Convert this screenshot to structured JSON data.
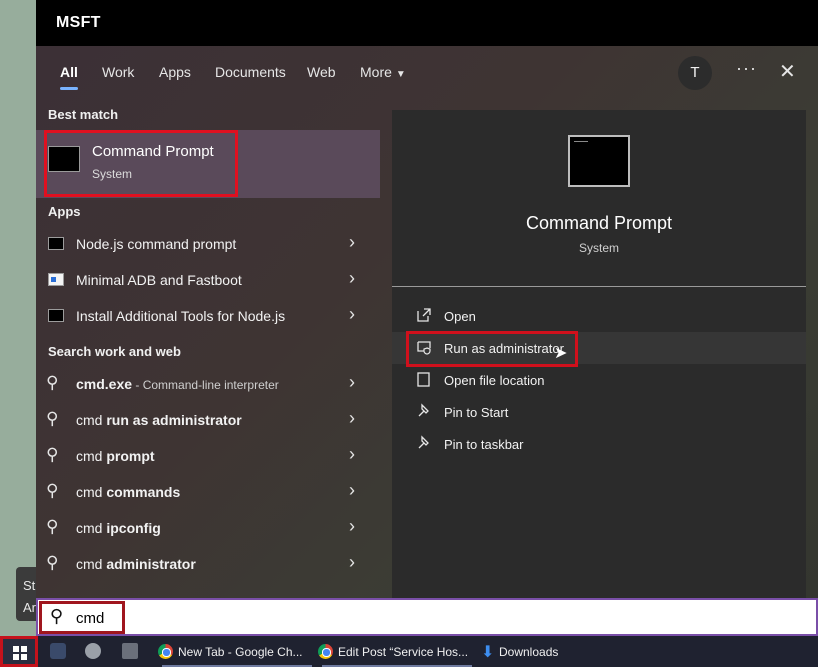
{
  "desktop": {
    "tooltip_line1": "St",
    "tooltip_line2": "Ar"
  },
  "window": {
    "title": "MSFT"
  },
  "tabs": [
    {
      "label": "All",
      "active": true
    },
    {
      "label": "Work"
    },
    {
      "label": "Apps"
    },
    {
      "label": "Documents"
    },
    {
      "label": "Web"
    },
    {
      "label": "More"
    }
  ],
  "account": {
    "avatar_initial": "T"
  },
  "header_actions": {
    "more_glyph": "···",
    "close_glyph": "✕"
  },
  "best_match": {
    "heading": "Best match",
    "name": "Command Prompt",
    "subtitle": "System"
  },
  "apps": {
    "heading": "Apps",
    "items": [
      {
        "label": "Node.js command prompt",
        "icon": "terminal-icon"
      },
      {
        "label": "Minimal ADB and Fastboot",
        "icon": "adb-icon"
      },
      {
        "label": "Install Additional Tools for Node.js",
        "icon": "terminal-icon"
      }
    ]
  },
  "web": {
    "heading": "Search work and web",
    "items": [
      {
        "prefix": "cmd.exe",
        "bold": "",
        "desc": " - Command-line interpreter"
      },
      {
        "prefix": "cmd ",
        "bold": "run as administrator",
        "desc": ""
      },
      {
        "prefix": "cmd ",
        "bold": "prompt",
        "desc": ""
      },
      {
        "prefix": "cmd ",
        "bold": "commands",
        "desc": ""
      },
      {
        "prefix": "cmd ",
        "bold": "ipconfig",
        "desc": ""
      },
      {
        "prefix": "cmd ",
        "bold": "administrator",
        "desc": ""
      }
    ]
  },
  "detail": {
    "name": "Command Prompt",
    "subtitle": "System",
    "actions": [
      {
        "label": "Open",
        "icon": "open-icon"
      },
      {
        "label": "Run as administrator",
        "icon": "shield-icon"
      },
      {
        "label": "Open file location",
        "icon": "folder-icon"
      },
      {
        "label": "Pin to Start",
        "icon": "pin-icon"
      },
      {
        "label": "Pin to taskbar",
        "icon": "pin-icon"
      }
    ]
  },
  "search": {
    "value": "cmd"
  },
  "taskbar": {
    "items": [
      {
        "label": "New Tab - Google Ch..."
      },
      {
        "label": "Edit Post “Service Hos..."
      },
      {
        "label": "Downloads"
      }
    ]
  },
  "colors": {
    "accent": "#7ab3ff",
    "highlight_red": "#e01020",
    "taskbar": "#1f2230"
  }
}
